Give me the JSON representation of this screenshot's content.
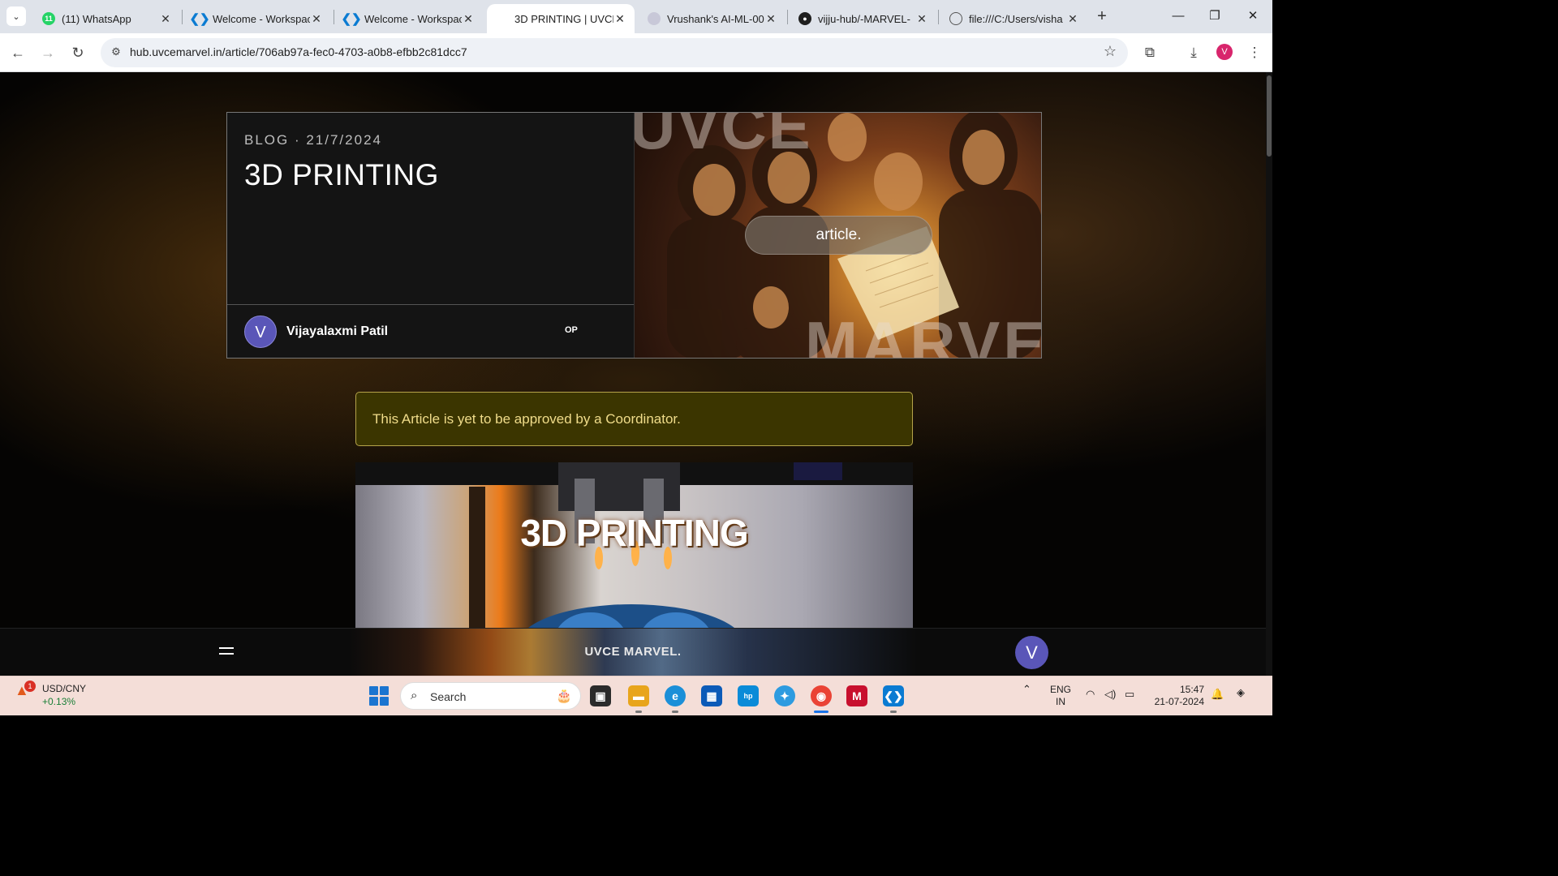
{
  "browser": {
    "tabs": [
      {
        "title": "(11) WhatsApp",
        "icon": "whatsapp-icon",
        "badge": "11"
      },
      {
        "title": "Welcome - Workspace",
        "icon": "vscode-icon"
      },
      {
        "title": "Welcome - Workspace",
        "icon": "vscode-icon"
      },
      {
        "title": "3D PRINTING | UVCE",
        "icon": "none",
        "active": true
      },
      {
        "title": "Vrushank's AI-ML-00",
        "icon": "ai-icon"
      },
      {
        "title": "vijju-hub/-MARVEL-",
        "icon": "github-icon"
      },
      {
        "title": "file:///C:/Users/visha",
        "icon": "globe-icon"
      }
    ],
    "url": "hub.uvcemarvel.in/article/706ab97a-fec0-4703-a0b8-efbb2c81dcc7",
    "profile_initial": "V"
  },
  "article": {
    "meta": "BLOG · 21/7/2024",
    "title": "3D PRINTING",
    "author_initial": "V",
    "author_name": "Vijayalaxmi Patil",
    "author_tag": "OP",
    "hero_pill": "article.",
    "hero_bg_word_top": "UVCE",
    "hero_bg_word_bottom": "MARVE",
    "notice": "This Article is yet to be approved by a Coordinator.",
    "cover_title": "3D PRINTING"
  },
  "site_bar": {
    "brand": "UVCE MARVEL.",
    "user_initial": "V"
  },
  "taskbar": {
    "widget_badge": "1",
    "widget_title": "USD/CNY",
    "widget_change": "+0.13%",
    "search_placeholder": "Search",
    "lang_top": "ENG",
    "lang_bottom": "IN",
    "time": "15:47",
    "date": "21-07-2024"
  },
  "colors": {
    "accent_avatar": "#5a56b8",
    "notice_bg": "#3b3500",
    "notice_text": "#f0dc8a",
    "notice_border": "#b5a34a"
  }
}
